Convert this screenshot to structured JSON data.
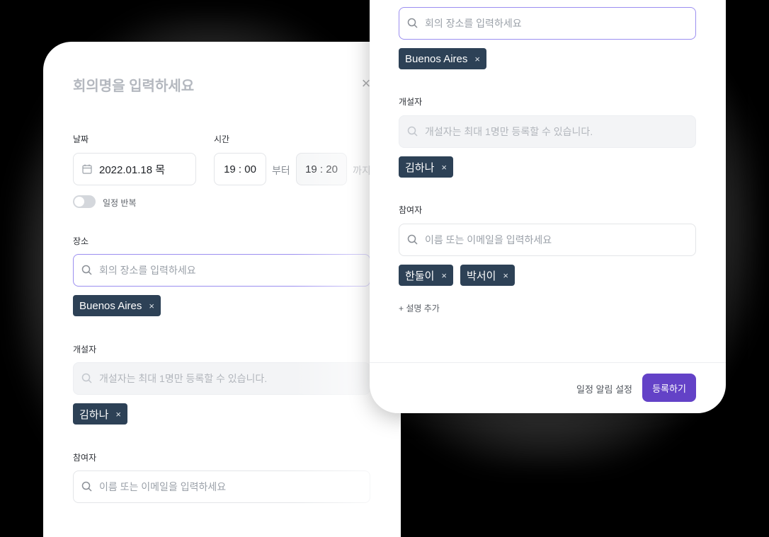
{
  "back": {
    "title": "회의명을 입력하세요",
    "close_icon": "×",
    "date_label": "날짜",
    "date_value": "2022.01.18 목",
    "time_label": "시간",
    "start_time": "19 : 00",
    "from_text": "부터",
    "end_time": "19 : 20",
    "until_text": "까지",
    "repeat_label": "일정 반복",
    "location_label": "장소",
    "location_placeholder": "회의 장소를 입력하세요",
    "location_chip": "Buenos Aires",
    "host_label": "개설자",
    "host_placeholder": "개설자는 최대 1명만 등록할 수 있습니다.",
    "host_chip": "김하나",
    "participant_label": "참여자",
    "participant_placeholder": "이름 또는 이메일을 입력하세요"
  },
  "front": {
    "location_placeholder": "회의 장소를 입력하세요",
    "location_chip": "Buenos Aires",
    "host_label": "개설자",
    "host_placeholder": "개설자는 최대 1명만 등록할 수 있습니다.",
    "host_chip": "김하나",
    "participant_label": "참여자",
    "participant_placeholder": "이름 또는 이메일을 입력하세요",
    "participant_chips": [
      "한둘이",
      "박서이"
    ],
    "add_description": "+ 설명 추가",
    "notification_settings": "일정 알림 설정",
    "submit": "등록하기"
  },
  "chip_remove_icon": "×",
  "colors": {
    "chip_bg": "#2d4156",
    "primary": "#6342c7",
    "focus_border": "#9b8ef0"
  }
}
